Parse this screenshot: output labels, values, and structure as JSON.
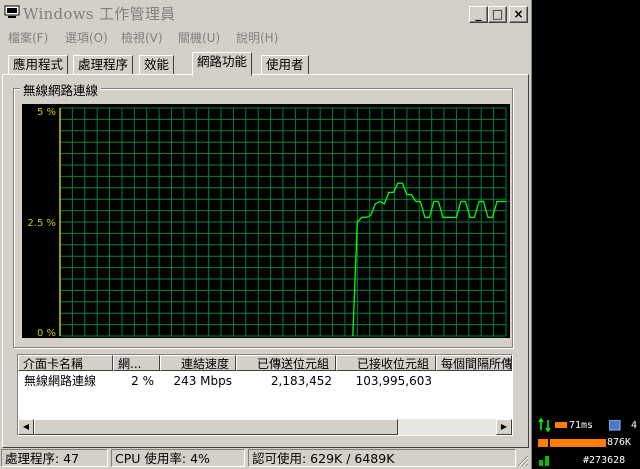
{
  "window": {
    "title": "Windows 工作管理員",
    "controls": {
      "minimize": "_",
      "maximize": "□",
      "close": "×"
    }
  },
  "menu": [
    "檔案(F)",
    "選項(O)",
    "檢視(V)",
    "關機(U)",
    "說明(H)"
  ],
  "tabs": [
    {
      "label": "應用程式",
      "active": false
    },
    {
      "label": "處理程序",
      "active": false
    },
    {
      "label": "效能",
      "active": false
    },
    {
      "label": "網路功能",
      "active": true
    },
    {
      "label": "使用者",
      "active": false
    }
  ],
  "network_group": {
    "label": "無線網路連線"
  },
  "chart_data": {
    "type": "line",
    "title": "無線網路連線",
    "y_ticks": [
      "5 %",
      "2.5 %",
      "0 %"
    ],
    "ylim": [
      0,
      5
    ],
    "grid": true,
    "line_color": "#00ff00",
    "grid_color": "#008040",
    "series": [
      {
        "values": [
          null,
          null,
          null,
          null,
          null,
          null,
          null,
          null,
          null,
          null,
          null,
          null,
          null,
          null,
          null,
          null,
          null,
          null,
          null,
          null,
          null,
          null,
          null,
          null,
          null,
          null,
          null,
          null,
          null,
          null,
          null,
          null,
          null,
          null,
          null,
          null,
          null,
          null,
          null,
          null,
          null,
          null,
          null,
          null,
          null,
          null,
          null,
          null,
          null,
          null,
          null,
          null,
          null,
          null,
          null,
          null,
          null,
          null,
          null,
          null,
          null,
          null,
          null,
          null,
          null,
          0,
          2.5,
          2.6,
          2.6,
          2.65,
          2.9,
          2.95,
          2.9,
          3.15,
          3.15,
          3.35,
          3.35,
          3.1,
          3.1,
          2.95,
          2.95,
          2.6,
          2.6,
          2.95,
          2.95,
          2.6,
          2.6,
          2.6,
          2.6,
          2.95,
          2.95,
          2.6,
          2.6,
          2.95,
          2.95,
          2.6,
          2.6,
          2.95,
          2.95,
          2.95
        ]
      }
    ]
  },
  "adapter_table": {
    "columns": [
      "介面卡名稱",
      "網...",
      "連結速度",
      "已傳送位元組",
      "已接收位元組",
      "每個間隔所傳送的位元組"
    ],
    "rows": [
      [
        "無線網路連線",
        "2 %",
        "243 Mbps",
        "2,183,452",
        "103,995,603",
        ""
      ]
    ]
  },
  "status": {
    "processes": "處理程序: 47",
    "cpu": "CPU 使用率: 4%",
    "commit": "認可使用: 629K / 6489K"
  },
  "tray": {
    "ping": "71ms",
    "count": "4",
    "memory": "876K",
    "id": "#273628"
  }
}
